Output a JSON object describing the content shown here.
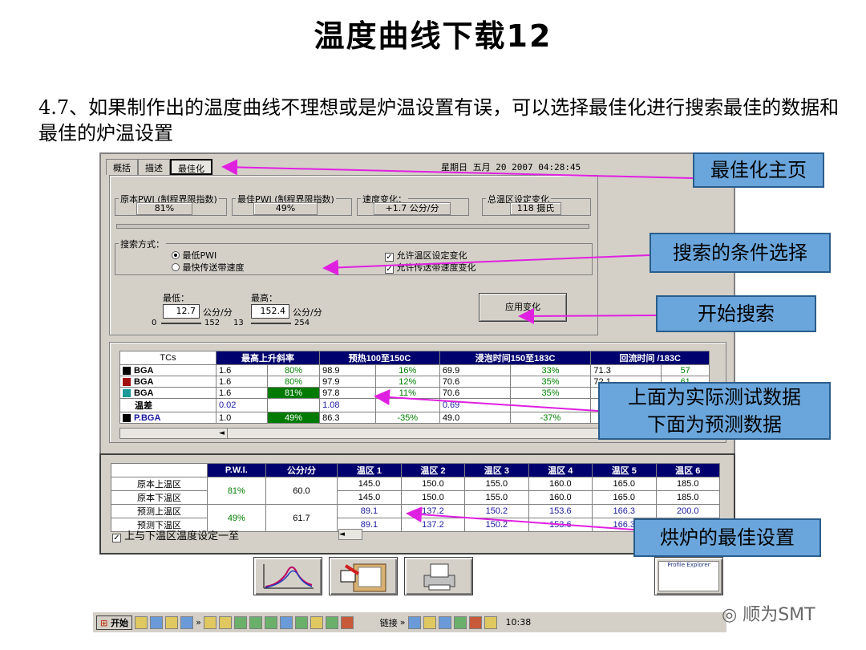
{
  "slide": {
    "title": "温度曲线下载12",
    "description": "4.7、如果制作出的温度曲线不理想或是炉温设置有误，可以选择最佳化进行搜索最佳的数据和最佳的炉温设置"
  },
  "app": {
    "tabs": [
      "概括",
      "描述",
      "最佳化"
    ],
    "active_tab": "最佳化",
    "datetime": "星期日 五月 20 2007 04:28:45",
    "metrics": {
      "orig_pwi_label": "原本PWI (制程界限指数)",
      "orig_pwi_value": "81%",
      "best_pwi_label": "最佳PWI (制程界限指数)",
      "best_pwi_value": "49%",
      "speed_change_label": "速度变化：",
      "speed_change_value": "+1.7 公分/分",
      "zone_change_label": "总温区设定变化",
      "zone_change_value": "118 摄氏"
    },
    "search": {
      "label": "搜索方式：",
      "option1": "最低PWI",
      "option2": "最快传送带速度",
      "check1": "允许温区设定变化",
      "check2": "允许传送带速度变化",
      "min_label": "最低：",
      "max_label": "最高：",
      "min_value": "12.7",
      "max_value": "152.4",
      "unit": "公分/分",
      "min_range_lo": "0",
      "min_range_hi": "152",
      "max_range_lo": "13",
      "max_range_hi": "254",
      "apply_button": "应用变化"
    },
    "data_table": {
      "headers": [
        "TCs",
        "最高上升斜率",
        "预热100至150C",
        "浸泡时间150至183C",
        "回流时间 /183C"
      ],
      "rows": [
        {
          "name": "BGA",
          "color": "#000000",
          "c1": "1.6",
          "p1": "80%",
          "c2": "98.9",
          "p2": "16%",
          "c3": "69.9",
          "p3": "33%",
          "c4": "71.3",
          "p4": "57"
        },
        {
          "name": "BGA",
          "color": "#a01010",
          "c1": "1.6",
          "p1": "80%",
          "c2": "97.9",
          "p2": "12%",
          "c3": "70.6",
          "p3": "35%",
          "c4": "72.1",
          "p4": "61"
        },
        {
          "name": "BGA",
          "color": "#1a9a9a",
          "c1": "1.6",
          "p1": "81%",
          "c2": "97.8",
          "p2": "11%",
          "c3": "70.6",
          "p3": "35%",
          "c4": "",
          "p4": ""
        },
        {
          "name": "温差",
          "color": "",
          "c1": "0.02",
          "p1": "",
          "c2": "1.08",
          "p2": "",
          "c3": "0.69",
          "p3": "",
          "c4": "",
          "p4": ""
        },
        {
          "name": "P.BGA",
          "color": "#000000",
          "c1": "1.0",
          "p1": "49%",
          "c2": "86.3",
          "p2": "-35%",
          "c3": "49.0",
          "p3": "-37%",
          "c4": "",
          "p4": ""
        }
      ]
    },
    "zone_table": {
      "headers": [
        "",
        "P.W.I.",
        "公分/分",
        "温区 1",
        "温区 2",
        "温区 3",
        "温区 4",
        "温区 5",
        "温区 6"
      ],
      "rows": [
        {
          "label": "原本上温区",
          "pwi": "81%",
          "speed": "60.0",
          "z": [
            "145.0",
            "150.0",
            "155.0",
            "160.0",
            "165.0",
            "185.0"
          ]
        },
        {
          "label": "原本下温区",
          "pwi": "",
          "speed": "",
          "z": [
            "145.0",
            "150.0",
            "155.0",
            "160.0",
            "165.0",
            "185.0"
          ]
        },
        {
          "label": "预测上温区",
          "pwi": "49%",
          "speed": "61.7",
          "z": [
            "89.1",
            "137.2",
            "150.2",
            "153.6",
            "166.3",
            "200.0"
          ]
        },
        {
          "label": "预测下温区",
          "pwi": "",
          "speed": "",
          "z": [
            "89.1",
            "137.2",
            "150.2",
            "153.6",
            "166.3",
            ""
          ]
        }
      ],
      "checkbox": "上与下温区温度设定一至"
    },
    "profile_button": "Profile Explorer"
  },
  "callouts": {
    "home": "最佳化主页",
    "conditions": "搜索的条件选择",
    "start": "开始搜索",
    "data_line1": "上面为实际测试数据",
    "data_line2": "下面为预测数据",
    "best": "烘炉的最佳设置"
  },
  "taskbar": {
    "start": "开始",
    "links": "链接",
    "time": "10:38"
  },
  "watermark": "顺为SMT",
  "colors": {
    "arrow": "#e020e0",
    "callout_bg": "#6aa6dc",
    "header_navy": "#00006e",
    "highlight_green": "#007a00"
  }
}
